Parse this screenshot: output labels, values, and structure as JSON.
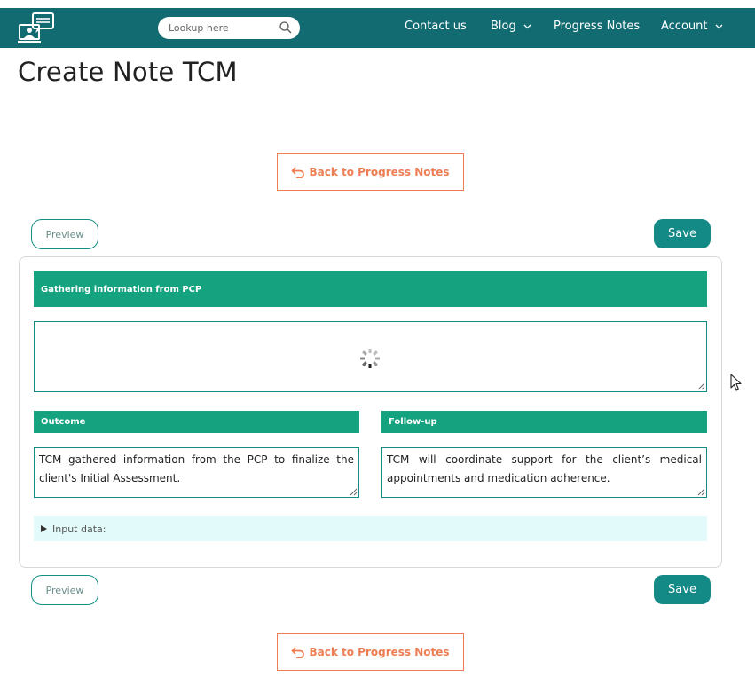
{
  "header": {
    "search": {
      "placeholder": "Lookup here"
    },
    "nav": [
      {
        "label": "Contact us"
      },
      {
        "label": "Blog"
      },
      {
        "label": "Progress Notes"
      },
      {
        "label": "Account"
      }
    ]
  },
  "page": {
    "title": "Create Note TCM",
    "back_label": "Back to Progress Notes",
    "preview_label": "Preview",
    "save_label": "Save"
  },
  "form": {
    "gathering_header": "Gathering information from PCP",
    "gathering_value": "",
    "outcome_header": "Outcome",
    "outcome_value": "TCM gathered information from the PCP to finalize the client's Initial Assessment.",
    "followup_header": "Follow-up",
    "followup_value": "TCM will coordinate support for the client’s medical appointments and medication adherence.",
    "input_data_label": "Input data:"
  },
  "colors": {
    "topbar": "#136b72",
    "accent_green": "#14a27f",
    "save_button": "#138a86",
    "back_button": "#ee7d52",
    "input_data_bg": "#e2fbfa"
  },
  "icons": {
    "logo": "chat-monitor-logo-icon",
    "search": "search-icon",
    "dropdown": "chevron-down-icon",
    "back": "undo-arrow-icon",
    "loading": "loading-spinner-icon",
    "disclosure": "triangle-right-icon"
  }
}
